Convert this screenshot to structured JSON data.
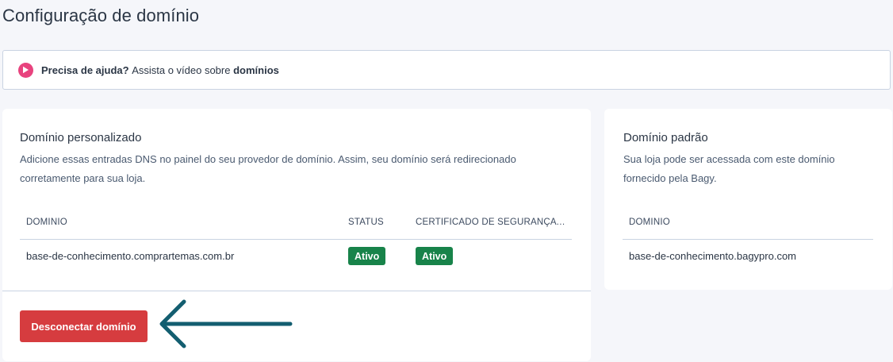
{
  "page": {
    "title": "Configuração de domínio"
  },
  "help": {
    "bold_text": "Precisa de ajuda?",
    "text": "Assista o vídeo sobre",
    "link_text": "domínios",
    "icon": "play-circle-icon"
  },
  "custom_domain": {
    "title": "Domínio personalizado",
    "description_line1": "Adicione essas entradas DNS no painel do seu provedor de domínio. Assim, seu domínio será redirecionado",
    "description_line2": "corretamente para sua loja.",
    "columns": [
      "DOMÍNIO",
      "STATUS",
      "CERTIFICADO DE SEGURANÇA (SSL)"
    ],
    "rows": [
      {
        "domain": "base-de-conhecimento.comprartemas.com.br",
        "status": "Ativo",
        "certificate": "Ativo"
      }
    ],
    "disconnect_label": "Desconectar domínio"
  },
  "default_domain": {
    "title": "Domínio padrão",
    "description_line1": "Sua loja pode ser acessada com este domínio",
    "description_line2": "fornecido pela Bagy.",
    "columns": [
      "DOMÍNIO"
    ],
    "rows": [
      {
        "domain": "base-de-conhecimento.bagypro.com"
      }
    ]
  },
  "colors": {
    "accent_pink": "#e8437e",
    "success_green": "#18834a",
    "danger_red": "#d63c3f",
    "annotation_arrow": "#135e70"
  }
}
